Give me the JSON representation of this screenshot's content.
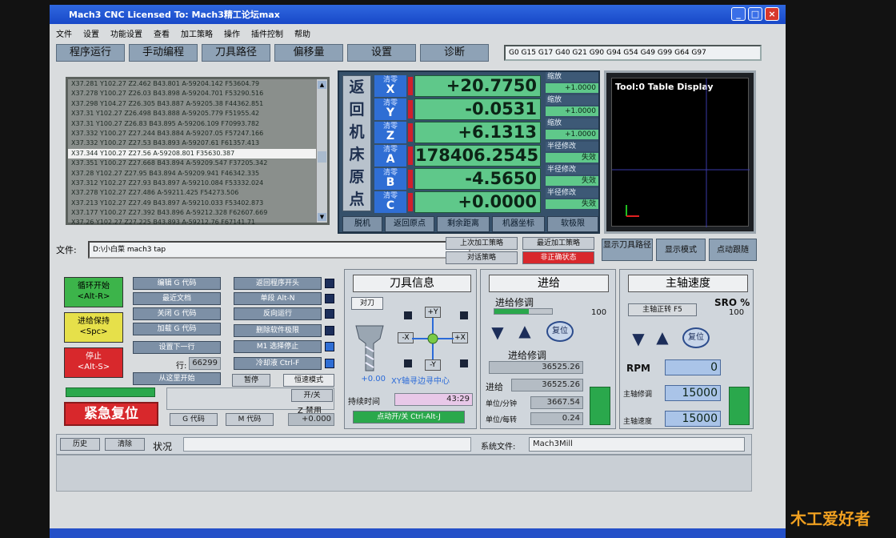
{
  "window": {
    "title": "Mach3 CNC   Licensed To: Mach3精工论坛max"
  },
  "menu": [
    "文件",
    "设置",
    "功能设置",
    "查看",
    "加工策略",
    "操作",
    "插件控制",
    "帮助"
  ],
  "tabs": [
    "程序运行",
    "手动编程",
    "刀具路径",
    "偏移量",
    "设置",
    "诊断"
  ],
  "gcodes": "G0 G15  G17 G40 G21 G90 G94 G54 G49 G99 G64 G97",
  "gcode_lines": [
    "X37.281 Y102.27 Z2.462 B43.801 A-59204.142 F53604.79",
    "X37.278 Y100.27 Z26.03 B43.898 A-59204.701 F53290.516",
    "X37.298 Y104.27 Z26.305 B43.887 A-59205.38 F44362.851",
    "X37.31 Y102.27 Z26.498 B43.888 A-59205.779 F51955.42",
    "X37.31 Y100.27 Z26.83 B43.895 A-59206.109 F70993.782",
    "X37.332 Y100.27 Z27.244 B43.884 A-59207.05 F57247.166",
    "X37.332 Y100.27 Z27.53 B43.893 A-59207.61 F61357.413",
    "X37.344 Y100.27 Z27.56 A-59208.801 F35630.387",
    "X37.351 Y100.27 Z27.668 B43.894 A-59209.547 F37205.342",
    "X37.28 Y102.27 Z27.95 B43.894 A-59209.941 F46342.335",
    "X37.312 Y102.27 Z27.93 B43.897 A-59210.084 F53332.024",
    "X37.278 Y102.27 Z27.486 A-59211.425 F54273.506",
    "X37.213 Y102.27 Z27.49 B43.897 A-59210.033 F53402.873",
    "X37.177 Y100.27 Z27.392 B43.896 A-59212.328 F62607.669",
    "X37.26 Y102.27 Z27.225 B43.893 A-59212.76 F67141.71"
  ],
  "gcode_highlight_index": 7,
  "dro": {
    "home_label": [
      "返",
      "回",
      "机",
      "床",
      "原",
      "点"
    ],
    "axes": [
      {
        "zero": "清零",
        "letter": "X",
        "value": "+20.7750",
        "scale_label": "缩放",
        "scale_value": "+1.0000"
      },
      {
        "zero": "清零",
        "letter": "Y",
        "value": "-0.0531",
        "scale_label": "缩放",
        "scale_value": "+1.0000"
      },
      {
        "zero": "清零",
        "letter": "Z",
        "value": "+6.1313",
        "scale_label": "缩放",
        "scale_value": "+1.0000"
      },
      {
        "zero": "清零",
        "letter": "A",
        "value": "178406.2545",
        "scale_label": "半径修改",
        "scale_value": "失效"
      },
      {
        "zero": "清零",
        "letter": "B",
        "value": "-4.5650",
        "scale_label": "半径修改",
        "scale_value": "失效"
      },
      {
        "zero": "清零",
        "letter": "C",
        "value": "+0.0000",
        "scale_label": "半径修改",
        "scale_value": "失效"
      }
    ],
    "buttons": [
      "脱机",
      "返回原点",
      "剩余距离",
      "机器坐标",
      "软极限"
    ]
  },
  "toolpath": {
    "label": "Tool:0    Table Display"
  },
  "file": {
    "label": "文件:",
    "value": "D:\\小白菜 mach3 tap"
  },
  "file_buttons": {
    "last_strategy": "上次加工策略",
    "recent_strategy": "最近加工策略",
    "dialog_strategy": "对话策略",
    "not_home": "非正确状态"
  },
  "mode_buttons": {
    "toolpath_display": "显示刀具路径",
    "display_mode": "显示模式",
    "jog_follow": "点动跟随"
  },
  "cycle": {
    "start": "循环开始\n<Alt-R>",
    "hold": "进给保持\n<Spc>",
    "stop": "停止\n<Alt-S>"
  },
  "program_buttons": [
    "编辑 G 代码",
    "最近文档",
    "关闭 G 代码",
    "加载 G 代码",
    "设置下一行"
  ],
  "line_label": "行:",
  "line_value": "66299",
  "run_from_here": "从这里开始",
  "option_buttons": [
    "返回程序开头",
    "单段 Alt-N",
    "反向运行",
    "删除软件极限",
    "M1 选择停止",
    "冷却液 Ctrl-F"
  ],
  "pause_label": "暂停",
  "const_velocity_label": "恒速模式",
  "open_close": "开/关",
  "z_disable": "Z 禁用",
  "z_value": "+0.000",
  "g_code_btn": "G 代码",
  "m_code_btn": "M 代码",
  "estop": "紧急复位",
  "tools": {
    "title": "刀具信息",
    "to_tool": "对刀",
    "tool_value": "+0.00",
    "xy_center": "XY轴寻边寻中心",
    "duration_label": "持续时间",
    "duration_value": "43:29",
    "jog_toggle": "点动开/关 Ctrl-Alt-J",
    "jog": {
      "up": "+Y",
      "down": "-Y",
      "left": "-X",
      "right": "+X"
    }
  },
  "feed": {
    "title": "进给",
    "override_label": "进给修调",
    "override_pct": "100",
    "reset": "复位",
    "override2_label": "进给修调",
    "override2_value": "36525.26",
    "feed_label": "进给",
    "feed_value": "36525.26",
    "unit_min_label": "单位/分钟",
    "unit_min_value": "3667.54",
    "unit_rev_label": "单位/每转",
    "unit_rev_value": "0.24",
    "override_fraction": 0.6
  },
  "spindle": {
    "title": "主轴速度",
    "cw": "主轴正转 F5",
    "sro_label": "SRO %",
    "sro_value": "100",
    "reset": "复位",
    "rpm_label": "RPM",
    "rpm_value": "0",
    "override_label": "主轴修调",
    "override_value": "15000",
    "speed_label": "主轴速度",
    "speed_value": "15000"
  },
  "status": {
    "history": "历史",
    "clear": "清除",
    "label": "状况",
    "profile_label": "系统文件:",
    "profile_value": "Mach3Mill"
  },
  "logo": "木工爱好者",
  "colors": {
    "accent": "#2f6ed4",
    "dro_green": "#5fc88a",
    "alarm_red": "#d8282c"
  }
}
